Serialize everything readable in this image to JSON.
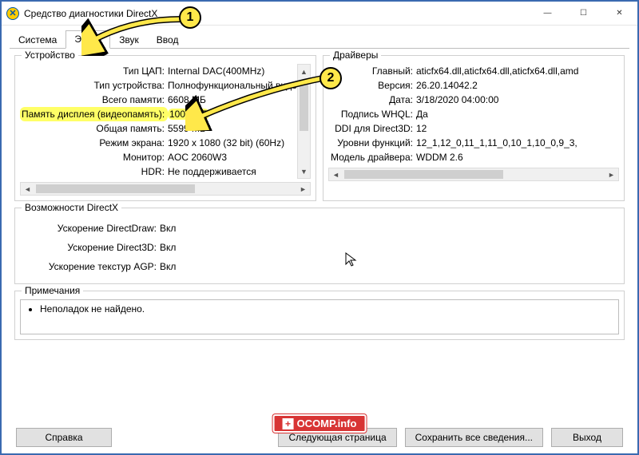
{
  "window": {
    "title": "Средство диагностики DirectX"
  },
  "tabs": [
    {
      "label": "Система"
    },
    {
      "label": "Экран"
    },
    {
      "label": "Звук"
    },
    {
      "label": "Ввод"
    }
  ],
  "device": {
    "legend": "Устройство",
    "dac_label": "Тип ЦАП:",
    "dac_value": "Internal DAC(400MHz)",
    "type_label": "Тип устройства:",
    "type_value": "Полнофункциональный видеоадапте",
    "mem_total_label": "Всего памяти:",
    "mem_total_value": "6608 МБ",
    "vram_label": "Память дисплея (видеопамять):",
    "vram_value": "1009 МБ",
    "shared_label": "Общая память:",
    "shared_value": "5599 МБ",
    "mode_label": "Режим экрана:",
    "mode_value": "1920 x 1080 (32 bit) (60Hz)",
    "monitor_label": "Монитор:",
    "monitor_value": "AOC 2060W3",
    "hdr_label": "HDR:",
    "hdr_value": "Не поддерживается"
  },
  "drivers": {
    "legend": "Драйверы",
    "main_label": "Главный:",
    "main_value": "aticfx64.dll,aticfx64.dll,aticfx64.dll,amd",
    "ver_label": "Версия:",
    "ver_value": "26.20.14042.2",
    "date_label": "Дата:",
    "date_value": "3/18/2020 04:00:00",
    "whql_label": "Подпись WHQL:",
    "whql_value": "Да",
    "ddi_label": "DDI для Direct3D:",
    "ddi_value": "12",
    "feat_label": "Уровни функций:",
    "feat_value": "12_1,12_0,11_1,11_0,10_1,10_0,9_3,",
    "model_label": "Модель драйвера:",
    "model_value": "WDDM 2.6"
  },
  "dx": {
    "legend": "Возможности DirectX",
    "dd_label": "Ускорение DirectDraw:",
    "d3d_label": "Ускорение Direct3D:",
    "agp_label": "Ускорение текстур AGP:",
    "enabled": "Вкл"
  },
  "notes": {
    "legend": "Примечания",
    "line": "Неполадок не найдено."
  },
  "footer": {
    "help": "Справка",
    "next": "Следующая страница",
    "save": "Сохранить все сведения...",
    "exit": "Выход"
  },
  "watermark": "OCOMP.info",
  "badges": {
    "one": "1",
    "two": "2"
  }
}
